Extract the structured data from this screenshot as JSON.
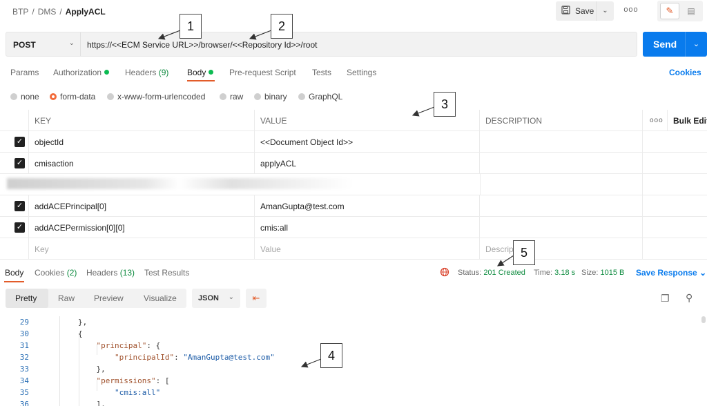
{
  "breadcrumb": {
    "part1": "BTP",
    "part2": "DMS",
    "current": "ApplyACL",
    "sep": "/"
  },
  "toolbar": {
    "save_label": "Save",
    "more_label": "ooo"
  },
  "request": {
    "method": "POST",
    "url": "https://<<ECM Service URL>>/browser/<<Repository Id>>/root",
    "send_label": "Send"
  },
  "request_tabs": {
    "params": "Params",
    "authorization": "Authorization",
    "headers": "Headers",
    "headers_count": "(9)",
    "body": "Body",
    "prerequest": "Pre-request Script",
    "tests": "Tests",
    "settings": "Settings",
    "cookies": "Cookies"
  },
  "body_types": {
    "none": "none",
    "form_data": "form-data",
    "urlencoded": "x-www-form-urlencoded",
    "raw": "raw",
    "binary": "binary",
    "graphql": "GraphQL",
    "selected": "form-data"
  },
  "form_table": {
    "headers": {
      "key": "KEY",
      "value": "VALUE",
      "description": "DESCRIPTION",
      "more": "ooo",
      "bulk_edit": "Bulk Edit"
    },
    "rows": [
      {
        "key": "objectId",
        "value": "<<Document Object Id>>",
        "checked": true
      },
      {
        "key": "cmisaction",
        "value": "applyACL",
        "checked": true
      },
      {
        "key": "",
        "value": "",
        "blurred": true
      },
      {
        "key": "addACEPrincipal[0]",
        "value": "AmanGupta@test.com",
        "checked": true
      },
      {
        "key": "addACEPermission[0][0]",
        "value": "cmis:all",
        "checked": true
      }
    ],
    "placeholder": {
      "key": "Key",
      "value": "Value",
      "description": "Descript"
    }
  },
  "response_tabs": {
    "body": "Body",
    "cookies": "Cookies",
    "cookies_count": "(2)",
    "headers": "Headers",
    "headers_count": "(13)",
    "test_results": "Test Results"
  },
  "response_status": {
    "status_label": "Status:",
    "status_value": "201 Created",
    "time_label": "Time:",
    "time_value": "3.18 s",
    "size_label": "Size:",
    "size_value": "1015 B",
    "save_response": "Save Response"
  },
  "view_controls": {
    "modes": [
      "Pretty",
      "Raw",
      "Preview",
      "Visualize"
    ],
    "active_mode": "Pretty",
    "format": "JSON"
  },
  "code": {
    "lines": [
      {
        "n": "29",
        "text": "        },"
      },
      {
        "n": "30",
        "text": "        {"
      },
      {
        "n": "31",
        "key": "\"principal\"",
        "rest": ": {",
        "indent": "            "
      },
      {
        "n": "32",
        "key": "\"principalId\"",
        "rest": ": ",
        "str": "\"AmanGupta@test.com\"",
        "indent": "                "
      },
      {
        "n": "33",
        "text": "            },"
      },
      {
        "n": "34",
        "key": "\"permissions\"",
        "rest": ": [",
        "indent": "            "
      },
      {
        "n": "35",
        "str": "\"cmis:all\"",
        "indent": "                "
      },
      {
        "n": "36",
        "text": "            ],"
      }
    ]
  },
  "callouts": [
    "1",
    "2",
    "3",
    "4",
    "5"
  ],
  "colors": {
    "accent": "#e25c2a",
    "primary": "#097bed",
    "success": "#0c8a3e"
  },
  "icons": [
    "save-icon",
    "chevron-down-icon",
    "more-icon",
    "pencil-icon",
    "document-icon",
    "globe-icon",
    "copy-icon",
    "search-icon",
    "wrap-icon",
    "checkbox-icon"
  ]
}
